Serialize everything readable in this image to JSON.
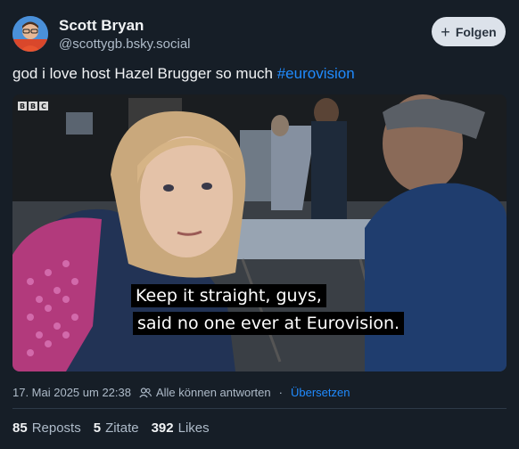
{
  "author": {
    "display_name": "Scott Bryan",
    "handle": "@scottygb.bsky.social"
  },
  "follow_button": {
    "label": "Folgen",
    "icon": "plus-icon"
  },
  "post": {
    "text": "god i love host Hazel Brugger so much ",
    "hashtag": "#eurovision"
  },
  "media": {
    "broadcaster_logo": [
      "B",
      "B",
      "C"
    ],
    "subtitle_line1": "Keep it straight, guys,",
    "subtitle_line2": "said no one ever at Eurovision."
  },
  "meta": {
    "timestamp": "17. Mai 2025 um 22:38",
    "reply_setting": "Alle können antworten",
    "separator": "·",
    "translate_label": "Übersetzen"
  },
  "stats": {
    "reposts_count": "85",
    "reposts_label": "Reposts",
    "quotes_count": "5",
    "quotes_label": "Zitate",
    "likes_count": "392",
    "likes_label": "Likes"
  },
  "colors": {
    "background": "#161e27",
    "link": "#208bfe",
    "muted": "#aebbc9"
  }
}
